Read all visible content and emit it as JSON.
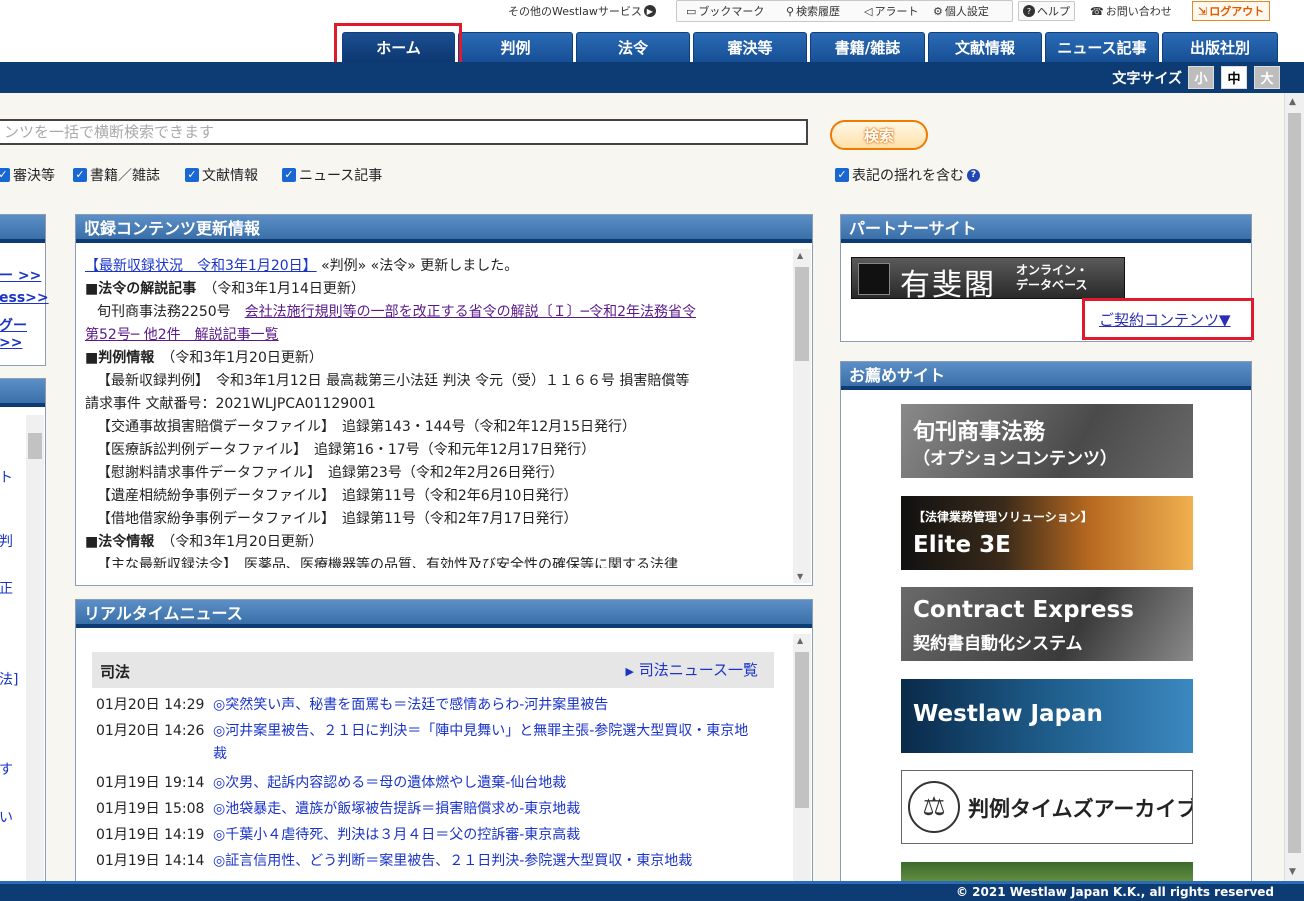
{
  "utility": {
    "other_services": "その他のWestlawサービス",
    "bookmark": "ブックマーク",
    "search_history": "検索履歴",
    "alert": "アラート",
    "personal_settings": "個人設定",
    "help": "ヘルプ",
    "contact": "お問い合わせ",
    "logout": "ログアウト"
  },
  "nav": {
    "tabs": [
      {
        "label": "ホーム",
        "active": true
      },
      {
        "label": "判例"
      },
      {
        "label": "法令"
      },
      {
        "label": "審決等"
      },
      {
        "label": "書籍/雑誌"
      },
      {
        "label": "文献情報"
      },
      {
        "label": "ニュース記事"
      },
      {
        "label": "出版社別"
      }
    ]
  },
  "font_size": {
    "label": "文字サイズ",
    "small": "小",
    "medium": "中",
    "large": "大"
  },
  "search": {
    "placeholder": "ンツを一括で横断検索できます",
    "button": "検索",
    "checkboxes": [
      {
        "label": "審決等",
        "checked": true
      },
      {
        "label": "書籍／雑誌",
        "checked": true
      },
      {
        "label": "文献情報",
        "checked": true
      },
      {
        "label": "ニュース記事",
        "checked": true
      }
    ],
    "variant_option": {
      "label": "表記の揺れを含む",
      "checked": true
    }
  },
  "left_panel": {
    "links": [
      "ー >>",
      "ess>>",
      "グー>>"
    ],
    "frags": [
      "ト",
      "判",
      "正",
      "法]",
      "す",
      "い"
    ]
  },
  "updates": {
    "title": "収録コンテンツ更新情報",
    "lines": [
      {
        "link": "【最新収録状況　令和3年1月20日】",
        "text": " «判例» «法令» 更新しました。"
      },
      {
        "heading": "■法令の解説記事",
        "text": "　（令和3年1月14日更新）"
      },
      {
        "text": "旬刊商事法務2250号　",
        "link": "会社法施行規則等の一部を改正する省令の解説〔Ｉ〕─令和2年法務省令"
      },
      {
        "link": "第52号─ 他2件　解説記事一覧"
      },
      {
        "heading": "■判例情報",
        "text": "　（令和3年1月20日更新）"
      },
      {
        "text": "【最新収録判例】　令和3年1月12日 最高裁第三小法廷 判決 令元（受）１１６６号 損害賠償等"
      },
      {
        "text": "請求事件 文献番号：2021WLJPCA01129001"
      },
      {
        "text": "【交通事故損害賠償データファイル】　追録第143・144号（令和2年12月15日発行）"
      },
      {
        "text": "【医療訴訟判例データファイル】　追録第16・17号（令和元年12月17日発行）"
      },
      {
        "text": "【慰謝料請求事件データファイル】　追録第23号（令和2年2月26日発行）"
      },
      {
        "text": "【遺産相続紛争事例データファイル】　追録第11号（令和2年6月10日発行）"
      },
      {
        "text": "【借地借家紛争事例データファイル】　追録第11号（令和2年7月17日発行）"
      },
      {
        "heading": "■法令情報",
        "text": "　（令和3年1月20日更新）"
      },
      {
        "text": "【主な最新収録法令】　医薬品、医療機器等の品質、有効性及び安全性の確保等に関する法律"
      }
    ]
  },
  "news": {
    "title": "リアルタイムニュース",
    "category": "司法",
    "more_link": "司法ニュース一覧",
    "items": [
      {
        "time": "01月20日 14:29",
        "title": "◎突然笑い声、秘書を面罵も＝法廷で感情あらわ-河井案里被告"
      },
      {
        "time": "01月20日 14:26",
        "title": "◎河井案里被告、２１日に判決＝「陣中見舞い」と無罪主張-参院選大型買収・東京地裁"
      },
      {
        "time": "01月19日 19:14",
        "title": "◎次男、起訴内容認める＝母の遺体燃やし遺棄-仙台地裁"
      },
      {
        "time": "01月19日 15:08",
        "title": "◎池袋暴走、遺族が飯塚被告提訴＝損害賠償求め-東京地裁"
      },
      {
        "time": "01月19日 14:19",
        "title": "◎千葉小４虐待死、判決は３月４日＝父の控訴審-東京高裁"
      },
      {
        "time": "01月19日 14:14",
        "title": "◎証言信用性、どう判断＝案里被告、２１日判決-参院選大型買収・東京地裁"
      }
    ]
  },
  "partner": {
    "title": "パートナーサイト",
    "yuhikaku_name": "有斐閣",
    "yuhikaku_sub1": "オンライン・",
    "yuhikaku_sub2": "データベース",
    "contract_link": "ご契約コンテンツ▼"
  },
  "recommended": {
    "title": "お薦めサイト",
    "banners": [
      {
        "line1": "旬刊商事法務",
        "line2": "（オプションコンテンツ）"
      },
      {
        "line1": "【法律業務管理ソリューション】",
        "line2": "Elite 3E"
      },
      {
        "line1": "Contract Express",
        "line2": "契約書自動化システム"
      },
      {
        "line1": "Westlaw Japan"
      },
      {
        "line1": "判例タイムズアーカイブス"
      }
    ]
  },
  "footer": {
    "copyright": "© 2021 Westlaw Japan K.K., all rights reserved"
  },
  "colors": {
    "nav_blue": "#174f95",
    "band_blue": "#0d3c75",
    "highlight_red": "#e01a2a",
    "link_blue": "#1a33c8",
    "search_orange": "#f07a00"
  }
}
